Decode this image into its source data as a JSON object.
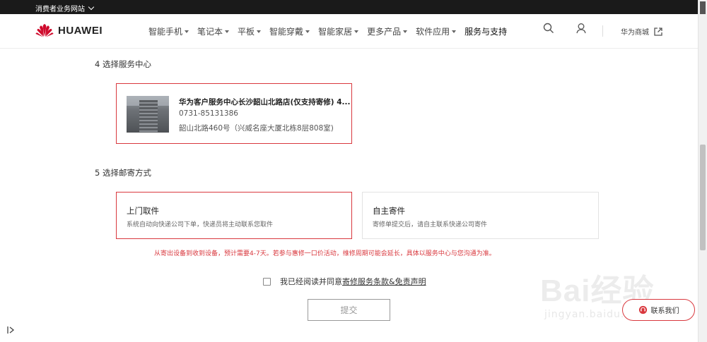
{
  "topbar": {
    "site_label": "消费者业务网站"
  },
  "brand": {
    "name": "HUAWEI",
    "accent": "#cf0a2c"
  },
  "nav": {
    "items": [
      {
        "label": "智能手机",
        "dropdown": true
      },
      {
        "label": "笔记本",
        "dropdown": true
      },
      {
        "label": "平板",
        "dropdown": true
      },
      {
        "label": "智能穿戴",
        "dropdown": true
      },
      {
        "label": "智能家居",
        "dropdown": true
      },
      {
        "label": "更多产品",
        "dropdown": true
      },
      {
        "label": "软件应用",
        "dropdown": true
      },
      {
        "label": "服务与支持",
        "dropdown": false
      }
    ],
    "store_label": "华为商城",
    "icons": [
      "search-icon",
      "user-icon",
      "external-link-icon"
    ]
  },
  "section4": {
    "title": "4 选择服务中心",
    "store": {
      "name": "华为客户服务中心长沙韶山北路店(仅支持寄修) 4...",
      "phone": "0731-85131386",
      "address": "韶山北路460号（兴威名座大厦北栋8层808室)"
    }
  },
  "section5": {
    "title": "5 选择邮寄方式",
    "options": [
      {
        "title": "上门取件",
        "desc": "系统自动向快递公司下单，快递员将主动联系您取件",
        "selected": true
      },
      {
        "title": "自主寄件",
        "desc": "寄修单提交后，请自主联系快递公司寄件",
        "selected": false
      }
    ],
    "notice": "从寄出设备到收到设备，预计需要4-7天。若参与惠修一口价活动，维修周期可能会延长，具体以服务中心与您沟通为准。"
  },
  "agreement": {
    "prefix": "我已经阅读并同意",
    "link": "寄修服务条款&免责声明",
    "checked": false
  },
  "submit_label": "提交",
  "contact_label": "联系我们",
  "watermark": {
    "big": "Bai经验",
    "small": "jingyan.baidu.com"
  },
  "colors": {
    "selected_border": "#d9383e",
    "notice": "#d9383e",
    "topbar": "#1a1a1a"
  }
}
